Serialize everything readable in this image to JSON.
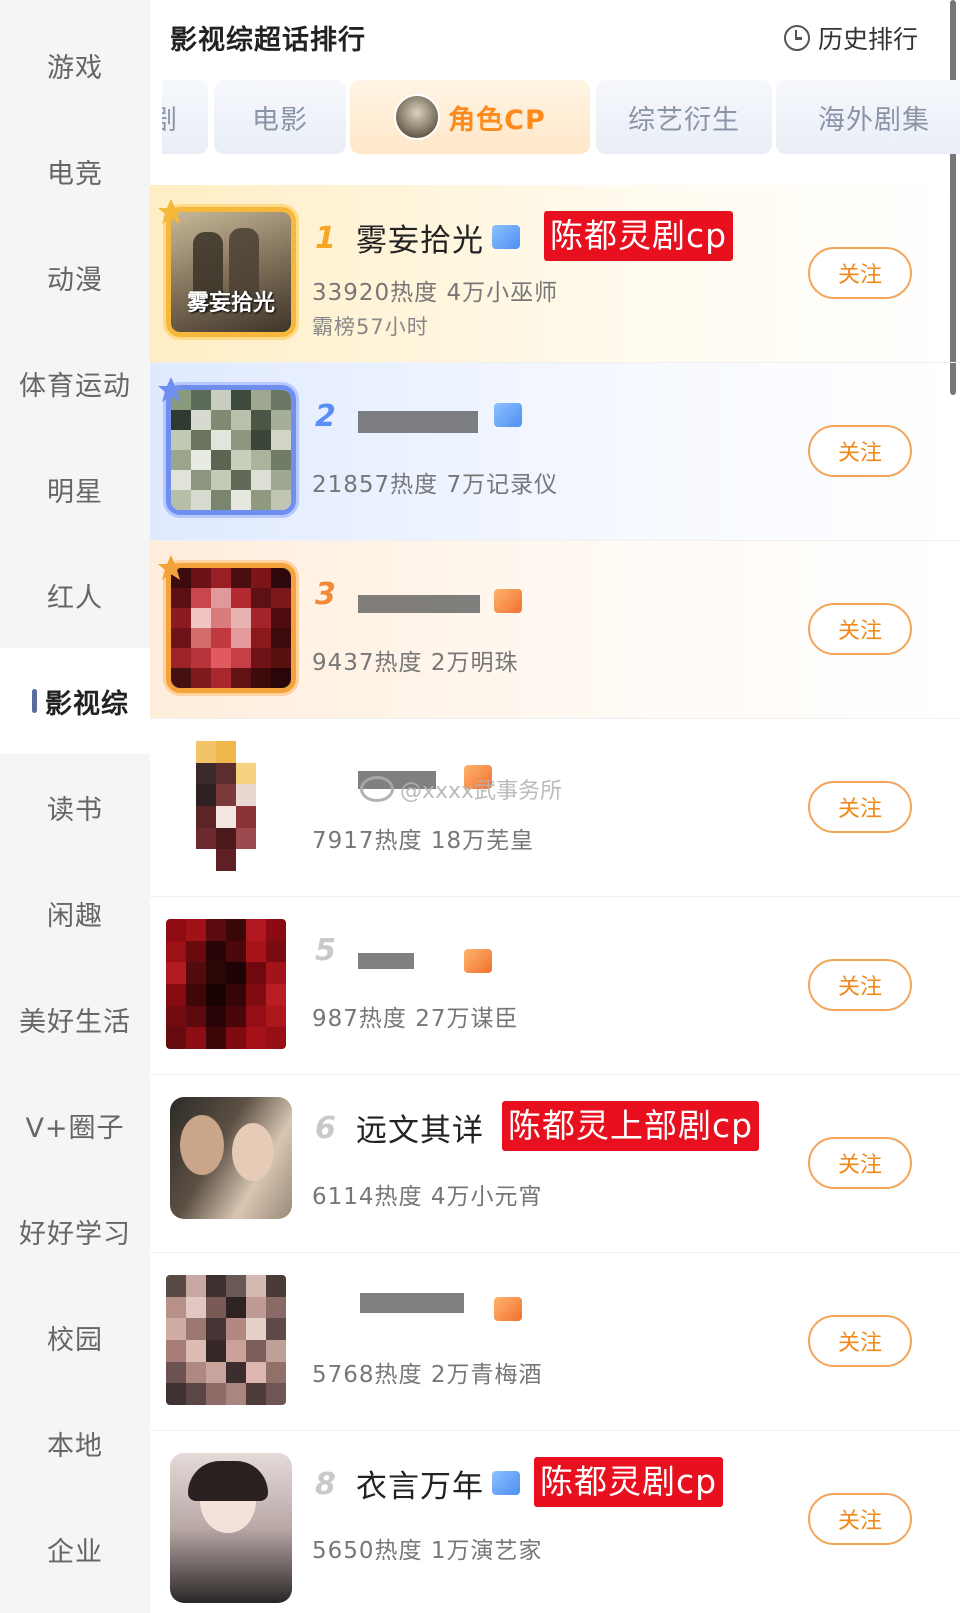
{
  "header": {
    "title": "影视综超话排行",
    "history_label": "历史排行"
  },
  "sidebar": {
    "items": [
      {
        "label": "游戏"
      },
      {
        "label": "电竞"
      },
      {
        "label": "动漫"
      },
      {
        "label": "体育运动"
      },
      {
        "label": "明星"
      },
      {
        "label": "红人"
      },
      {
        "label": "影视综",
        "active": true
      },
      {
        "label": "读书"
      },
      {
        "label": "闲趣"
      },
      {
        "label": "美好生活"
      },
      {
        "label": "V+圈子"
      },
      {
        "label": "好好学习"
      },
      {
        "label": "校园"
      },
      {
        "label": "本地"
      },
      {
        "label": "企业"
      }
    ]
  },
  "tabs": [
    {
      "label": "剧"
    },
    {
      "label": "电影"
    },
    {
      "label": "角色CP",
      "active": true
    },
    {
      "label": "综艺衍生"
    },
    {
      "label": "海外剧集"
    }
  ],
  "follow_label": "关注",
  "rows": [
    {
      "rank": "1",
      "name": "雾妄拾光",
      "tag": "陈都灵剧cp",
      "stats": "33920热度 4万小巫师",
      "sub": "霸榜57小时"
    },
    {
      "rank": "2",
      "name": "",
      "tag": "",
      "stats": "21857热度 7万记录仪",
      "sub": ""
    },
    {
      "rank": "3",
      "name": "",
      "tag": "",
      "stats": "9437热度 2万明珠",
      "sub": ""
    },
    {
      "rank": "",
      "name": "",
      "tag": "",
      "stats": "7917热度 18万芜皇",
      "sub": ""
    },
    {
      "rank": "5",
      "name": "",
      "tag": "",
      "stats": "987热度 27万谋臣",
      "sub": ""
    },
    {
      "rank": "6",
      "name": "远文其详",
      "tag": "陈都灵上部剧cp",
      "stats": "6114热度 4万小元宵",
      "sub": ""
    },
    {
      "rank": "",
      "name": "",
      "tag": "",
      "stats": "5768热度 2万青梅酒",
      "sub": ""
    },
    {
      "rank": "8",
      "name": "衣言万年",
      "tag": "陈都灵剧cp",
      "stats": "5650热度 1万演艺家",
      "sub": ""
    }
  ],
  "watermark": "@xxxx武事务所",
  "colors": {
    "accent": "#f08a1c",
    "red_tag": "#e8101f",
    "active_tab_text": "#ff8a1c"
  }
}
